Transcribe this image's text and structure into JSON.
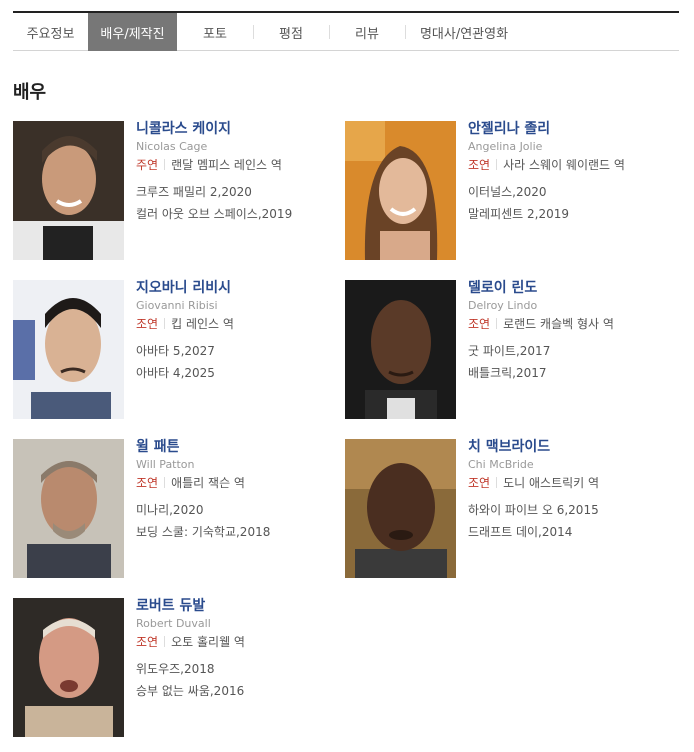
{
  "tabs": [
    {
      "label": "주요정보",
      "active": false
    },
    {
      "label": "배우/제작진",
      "active": true
    },
    {
      "label": "포토",
      "active": false
    },
    {
      "label": "평점",
      "active": false
    },
    {
      "label": "리뷰",
      "active": false
    },
    {
      "label": "명대사/연관영화",
      "active": false
    }
  ],
  "section_title": "배우",
  "actors": [
    {
      "name_ko": "니콜라스 케이지",
      "name_en": "Nicolas Cage",
      "role_type": "주연",
      "role": "랜달 멤피스 레인스 역",
      "films": [
        "크루즈 패밀리 2,2020",
        "컬러 아웃 오브 스페이스,2019"
      ]
    },
    {
      "name_ko": "안젤리나 졸리",
      "name_en": "Angelina Jolie",
      "role_type": "조연",
      "role": "사라 스웨이 웨이랜드 역",
      "films": [
        "이터널스,2020",
        "말레피센트 2,2019"
      ]
    },
    {
      "name_ko": "지오바니 리비시",
      "name_en": "Giovanni Ribisi",
      "role_type": "조연",
      "role": "킵 레인스 역",
      "films": [
        "아바타 5,2027",
        "아바타 4,2025"
      ]
    },
    {
      "name_ko": "델로이 린도",
      "name_en": "Delroy Lindo",
      "role_type": "조연",
      "role": "로랜드 캐슬벡 형사 역",
      "films": [
        "굿 파이트,2017",
        "배틀크릭,2017"
      ]
    },
    {
      "name_ko": "윌 패튼",
      "name_en": "Will Patton",
      "role_type": "조연",
      "role": "애틀리 잭슨 역",
      "films": [
        "미나리,2020",
        "보딩 스쿨: 기숙학교,2018"
      ]
    },
    {
      "name_ko": "치 맥브라이드",
      "name_en": "Chi McBride",
      "role_type": "조연",
      "role": "도니 애스트릭키 역",
      "films": [
        "하와이 파이브 오 6,2015",
        "드래프트 데이,2014"
      ]
    },
    {
      "name_ko": "로버트 듀발",
      "name_en": "Robert Duvall",
      "role_type": "조연",
      "role": "오토 홀리웰 역",
      "films": [
        "위도우즈,2018",
        "승부 없는 싸움,2016"
      ]
    }
  ],
  "colors": {
    "link": "#2a4b8d",
    "role_type": "#c0392b",
    "active_tab": "#777777"
  }
}
